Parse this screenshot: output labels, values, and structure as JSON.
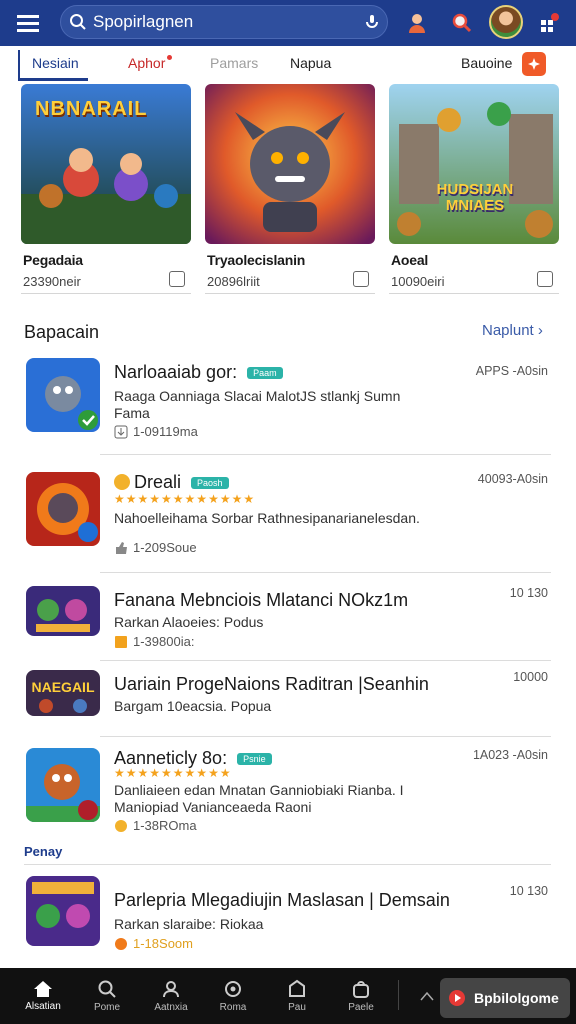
{
  "header": {
    "search_text": "Spopirlagnen",
    "icons": [
      "menu-icon",
      "search-icon",
      "mic-icon",
      "user-icon",
      "search-alert-icon",
      "avatar",
      "notification-icon"
    ]
  },
  "tabs": [
    {
      "label": "Nesiain",
      "active": true
    },
    {
      "label": "Aphor",
      "dot": true
    },
    {
      "label": "Pamars"
    },
    {
      "label": "Napua"
    },
    {
      "label": "Bauoine"
    }
  ],
  "featured": [
    {
      "art": "NBNARAIL",
      "title": "Pegadaia",
      "sub": "23390neir"
    },
    {
      "art": "",
      "title": "Tryaolecislanin",
      "sub": "20896lriit"
    },
    {
      "art": "HUDSIJAN MNIAES",
      "title": "Aoeal",
      "sub": "10090eiri"
    }
  ],
  "section": {
    "title": "Bapacain",
    "link": "Naplunt"
  },
  "list": [
    {
      "title": "Narloaaiab gor:",
      "badge": "Paam",
      "desc": "Raaga Oanniaga Slacai MalotJS stlankj Sumn Fama",
      "meta": "1-09119ma",
      "right": "APPS -A0sin",
      "meta_icon": "download-icon"
    },
    {
      "title": "Dreali",
      "badge": "Paosh",
      "stars": "★★★★★★★★★★★★",
      "desc": "Nahoelleihama Sorbar Rathnesipanarianelesdan.",
      "meta": "1-209Soue",
      "right": "40093-A0sin",
      "meta_icon": "thumb-icon"
    },
    {
      "title": "Fanana Mebnciois Mlatanci NOkz1m",
      "desc": "Rarkan Alaoeies: Podus",
      "meta": "1-39800ia:",
      "right": "10 130",
      "meta_icon": "book-icon"
    },
    {
      "title": "Uariain ProgeNaions Raditran |Seanhin",
      "desc": "Bargam 10eacsia. Popua",
      "right": "10000",
      "meta_icon": ""
    },
    {
      "title": "Aanneticly 8o:",
      "badge": "Psnie",
      "stars": "★★★★★★★★★★",
      "desc": "Danliaieen edan Mnatan Ganniobiaki Rianba. I Maniopiad Vanianceaeda Raoni",
      "meta": "1-38ROma",
      "right": "1A023 -A0sin",
      "meta_icon": "coin-icon"
    },
    {
      "title": "Parlepria Mlegadiujin Maslasan | Demsain",
      "desc": "Rarkan slaraibe: Riokaa",
      "meta": "1-18Soom",
      "right": "10 130",
      "meta_icon": "coin-icon"
    }
  ],
  "divider_label": "Penay",
  "bottom_nav": [
    {
      "label": "Alsatian",
      "icon": "home-icon",
      "active": true
    },
    {
      "label": "Pome",
      "icon": "search-icon"
    },
    {
      "label": "Aatnxia",
      "icon": "profile-icon"
    },
    {
      "label": "Roma",
      "icon": "gear-icon"
    },
    {
      "label": "Pau",
      "icon": "notes-icon"
    },
    {
      "label": "Paele",
      "icon": "bag-icon"
    }
  ],
  "play_button": {
    "label": "Bpbilolgome"
  },
  "colors": {
    "brand": "#1e3c8c",
    "accent": "#f05a28",
    "badge": "#2bb3a8",
    "star": "#f4a21d"
  }
}
